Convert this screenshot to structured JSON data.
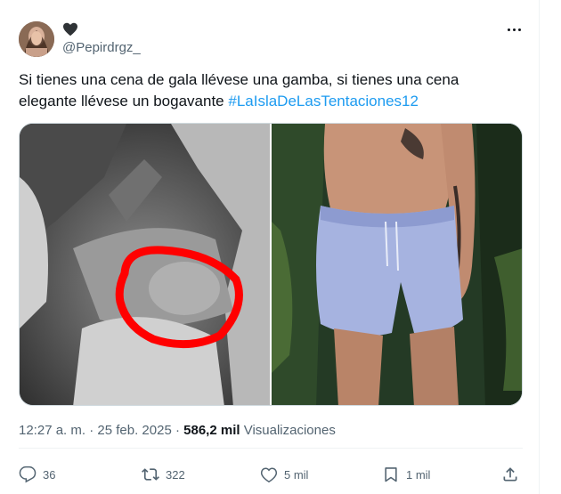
{
  "tweet": {
    "handle": "@Pepirdrgz_",
    "text_plain": "Si tienes una cena de gala llévese una gamba, si tienes una cena elegante llévese un bogavante ",
    "hashtag": "#LaIslaDeLasTentaciones12",
    "time": "12:27 a. m.",
    "separator": " · ",
    "date": "25 feb. 2025",
    "views_count": "586,2 mil",
    "views_label": "Visualizaciones"
  },
  "actions": {
    "replies": "36",
    "reposts": "322",
    "likes": "5 mil",
    "bookmarks": "1 mil"
  },
  "icons": {
    "name_badge": "black-heart-icon",
    "more": "more-dots-icon",
    "reply": "reply-bubble-icon",
    "repost": "repost-arrows-icon",
    "like": "heart-outline-icon",
    "bookmark": "bookmark-icon",
    "share": "share-upload-icon"
  },
  "colors": {
    "text": "#0f1419",
    "muted": "#536471",
    "link": "#1d9bf0",
    "border": "#cfd9de",
    "circle_annotation": "#ff0000"
  }
}
